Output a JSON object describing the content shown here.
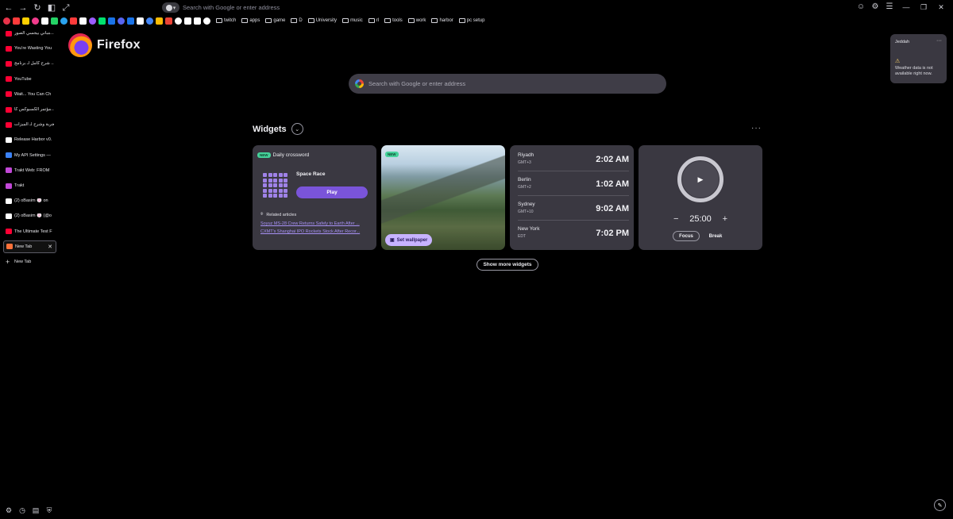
{
  "toolbar": {
    "back_icon": "arrow-left-icon",
    "forward_icon": "arrow-right-icon",
    "reload_icon": "reload-icon",
    "url_placeholder": "Search with Google or enter address",
    "right_icons": [
      "extensions-icon",
      "account-icon",
      "menu-icon"
    ],
    "window_controls": [
      "minimize-icon",
      "maximize-icon",
      "close-icon"
    ]
  },
  "bookmarks": {
    "icon_colors": [
      "#e8334a",
      "#ff3b3b",
      "#ffd000",
      "#f23b8c",
      "#ffffff",
      "#25d366",
      "#2aa3ef",
      "#ff3b3b",
      "#ffffff",
      "#9b5cff",
      "#00e16e",
      "#1a73e8",
      "#5865f2",
      "#1a73e8",
      "#ffffff",
      "#4285f4",
      "#fbbc05",
      "#ea4335",
      "#ffffff",
      "#ffffff",
      "#ffffff",
      "#ffffff"
    ],
    "folders": [
      "twitch",
      "apps",
      "game",
      "D",
      "University",
      "music",
      "rl",
      "tools",
      "work",
      "harbor",
      "pc setup"
    ]
  },
  "sidebar": {
    "tabs": [
      {
        "label": "مباني بيجسي الصور...",
        "color": "#ff0033"
      },
      {
        "label": "You're Wasting You",
        "color": "#ff0033"
      },
      {
        "label": "شرح كامل لـ برنامج ...",
        "color": "#ff0033"
      },
      {
        "label": "YouTube",
        "color": "#ff0033"
      },
      {
        "label": "Wait... You Can Ch",
        "color": "#ff0033"
      },
      {
        "label": "مؤتمر الكسبوكس كا...",
        "color": "#ff0033"
      },
      {
        "label": "تجربة وشرح لـ الميزات...",
        "color": "#ff0033"
      },
      {
        "label": "Release Harbor v0.",
        "color": "#ffffff"
      },
      {
        "label": "My API Settings —",
        "color": "#3b82f6"
      },
      {
        "label": "Trakt Web: FROM",
        "color": "#c248d8"
      },
      {
        "label": "Trakt",
        "color": "#c248d8"
      },
      {
        "label": "(2) oBasim 🍥 on",
        "color": "#ffffff"
      },
      {
        "label": "(2) oBasim 🍥 (@o",
        "color": "#ffffff"
      },
      {
        "label": "The Ultimate Test F",
        "color": "#ff0033"
      },
      {
        "label": "New Tab",
        "color": "#ff7139"
      },
      {
        "label": "New Tab",
        "color": "none"
      }
    ],
    "footer_icons": [
      "settings-icon",
      "history-icon",
      "bookmarks-icon",
      "vpn-icon"
    ]
  },
  "brand": {
    "name": "Firefox"
  },
  "search": {
    "placeholder": "Search with Google or enter address"
  },
  "widgets": {
    "title": "Widgets",
    "crossword": {
      "badge": "NEW",
      "header": "Daily crossword",
      "puzzle": "Space Race",
      "play": "Play",
      "related": "Related articles",
      "links": [
        "Soyuz MS-28 Crew Returns Safely to Earth After ...",
        "CXMT's Shanghai IPO Rockets Stock After Recor..."
      ]
    },
    "wallpaper": {
      "badge": "NEW",
      "button": "Set wallpaper"
    },
    "clocks": [
      {
        "city": "Riyadh",
        "offset": "GMT+3",
        "time": "2:02 AM"
      },
      {
        "city": "Berlin",
        "offset": "GMT+2",
        "time": "1:02 AM"
      },
      {
        "city": "Sydney",
        "offset": "GMT+10",
        "time": "9:02 AM"
      },
      {
        "city": "New York",
        "offset": "EDT",
        "time": "7:02 PM"
      }
    ],
    "timer": {
      "value": "25:00",
      "minus": "−",
      "plus": "+",
      "focus": "Focus",
      "break": "Break"
    },
    "show_more": "Show more widgets"
  },
  "weather": {
    "city": "Jeddah",
    "message": "Weather data is not available right now."
  }
}
